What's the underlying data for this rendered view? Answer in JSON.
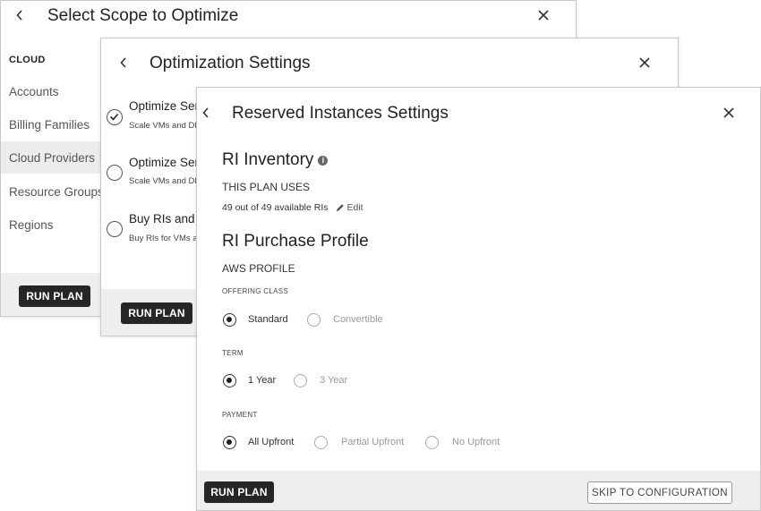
{
  "panel1": {
    "title": "Select Scope to Optimize",
    "section_header": "CLOUD",
    "nav_items": [
      "Accounts",
      "Billing Families",
      "Cloud Providers",
      "Resource Groups",
      "Regions"
    ],
    "selected_item": "Cloud Providers",
    "run_plan": "RUN PLAN"
  },
  "panel2": {
    "title": "Optimization Settings",
    "options": [
      {
        "title": "Optimize Ser",
        "subtitle": "Scale VMs and DE",
        "checked": true
      },
      {
        "title": "Optimize Ser",
        "subtitle": "Scale VMs and DE",
        "checked": false
      },
      {
        "title": "Buy RIs and D",
        "subtitle": "Buy RIs for VMs a",
        "checked": false
      }
    ],
    "run_plan": "RUN PLAN"
  },
  "panel3": {
    "title": "Reserved Instances Settings",
    "ri_inventory": {
      "heading": "RI Inventory",
      "plan_uses_label": "THIS PLAN USES",
      "usage_text": "49 out of 49 available RIs",
      "edit_label": "Edit"
    },
    "purchase_profile": {
      "heading": "RI Purchase Profile",
      "profile_label": "AWS PROFILE",
      "offering_class": {
        "label": "OFFERING CLASS",
        "options": [
          "Standard",
          "Convertible"
        ],
        "selected": "Standard"
      },
      "term": {
        "label": "TERM",
        "options": [
          "1 Year",
          "3 Year"
        ],
        "selected": "1 Year"
      },
      "payment": {
        "label": "PAYMENT",
        "options": [
          "All Upfront",
          "Partial Upfront",
          "No Upfront"
        ],
        "selected": "All Upfront"
      }
    },
    "run_plan": "RUN PLAN",
    "skip": "SKIP TO CONFIGURATION"
  },
  "icons": {
    "back": "chevron-left-icon",
    "close": "close-icon",
    "info": "info-icon",
    "edit": "pencil-icon",
    "check": "checkmark-icon"
  }
}
